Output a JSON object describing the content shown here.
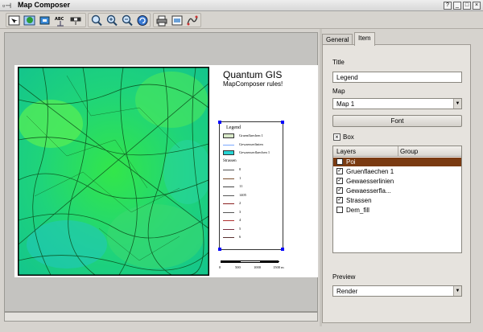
{
  "window": {
    "title": "Map Composer",
    "controls": [
      "?",
      "_",
      "□",
      "×"
    ]
  },
  "toolbar": {
    "icons": [
      "general-tool-icon",
      "add-map-icon",
      "add-label-icon",
      "add-legend-icon",
      "add-scalebar-icon",
      "zoom-full-icon",
      "zoom-in-icon",
      "zoom-out-icon",
      "refresh-icon",
      "print-icon",
      "export-image-icon",
      "export-svg-icon"
    ],
    "label_tool_text": "ABC"
  },
  "canvas": {
    "title": "Quantum GIS",
    "subtitle": "MapComposer rules!",
    "legend": {
      "title": "Legend",
      "items": [
        {
          "label": "Gruenflaechen 1",
          "kind": "fill",
          "color": "#d8e8c8"
        },
        {
          "label": "Gewaesserlinien",
          "kind": "line",
          "color": "#7aa8ff"
        },
        {
          "label": "Gewaesserflaechen 1",
          "kind": "fill",
          "color": "#27d4d4"
        },
        {
          "label": "Strassen",
          "kind": "header",
          "color": "#000000"
        },
        {
          "label": "0",
          "kind": "line",
          "color": "#555555"
        },
        {
          "label": "1",
          "kind": "line",
          "color": "#7a4b2a"
        },
        {
          "label": "11",
          "kind": "line",
          "color": "#444444"
        },
        {
          "label": "1405",
          "kind": "line",
          "color": "#555555"
        },
        {
          "label": "2",
          "kind": "line",
          "color": "#8a2020"
        },
        {
          "label": "3",
          "kind": "line",
          "color": "#555555"
        },
        {
          "label": "4",
          "kind": "line",
          "color": "#b03030"
        },
        {
          "label": "5",
          "kind": "line",
          "color": "#7a3040"
        },
        {
          "label": "6",
          "kind": "line",
          "color": "#5a3030"
        }
      ]
    },
    "scalebar": {
      "ticks": [
        "0",
        "500",
        "1000",
        "1500 m"
      ]
    }
  },
  "panel": {
    "tabs": [
      {
        "label": "General"
      },
      {
        "label": "Item"
      }
    ],
    "title_label": "Title",
    "title_value": "Legend",
    "map_label": "Map",
    "map_value": "Map 1",
    "font_button": "Font",
    "box_label": "Box",
    "box_checked": "×",
    "layers_header": "Layers",
    "group_header": "Group",
    "layers": [
      {
        "name": "Poi",
        "checked": "",
        "selected": true
      },
      {
        "name": "Gruenflaechen 1",
        "checked": "✓",
        "selected": false
      },
      {
        "name": "Gewaesserlinien",
        "checked": "✓",
        "selected": false
      },
      {
        "name": "Gewaesserfla...",
        "checked": "✓",
        "selected": false
      },
      {
        "name": "Strassen",
        "checked": "✓",
        "selected": false
      },
      {
        "name": "Dem_fill",
        "checked": "",
        "selected": false
      }
    ],
    "preview_label": "Preview",
    "preview_value": "Render"
  }
}
